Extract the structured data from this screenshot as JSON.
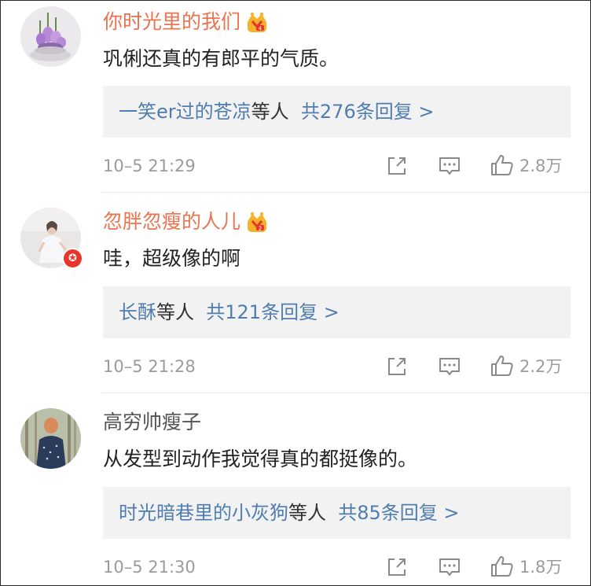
{
  "comments": [
    {
      "username": "你时光里的我们",
      "vip": true,
      "text": "巩俐还真的有郎平的气质。",
      "reply_users": "一笑er过的苍凉",
      "reply_mid": "等人",
      "reply_count": "共276条回复 >",
      "time": "10–5 21:29",
      "likes": "2.8万"
    },
    {
      "username": "忽胖忽瘦的人儿",
      "vip": true,
      "verified_badge": "✪",
      "text": "哇，超级像的啊",
      "reply_users": "长酥",
      "reply_mid": "等人",
      "reply_count": "共121条回复 >",
      "time": "10–5 21:28",
      "likes": "2.2万"
    },
    {
      "username": "高穷帅瘦子",
      "vip": false,
      "text": "从发型到动作我觉得真的都挺像的。",
      "reply_users": "时光暗巷里的小灰狗",
      "reply_mid": "等人",
      "reply_count": "共85条回复 >",
      "time": "10–5 21:30",
      "likes": "1.8万"
    }
  ],
  "icons": {
    "share": "share-icon",
    "comment": "comment-icon",
    "like": "thumbs-up-icon",
    "crown": "vip-crown-icon"
  },
  "colors": {
    "vip_name": "#eb7350",
    "link": "#507daf",
    "meta": "#9b9b9b",
    "reply_bg": "#f2f2f2"
  }
}
